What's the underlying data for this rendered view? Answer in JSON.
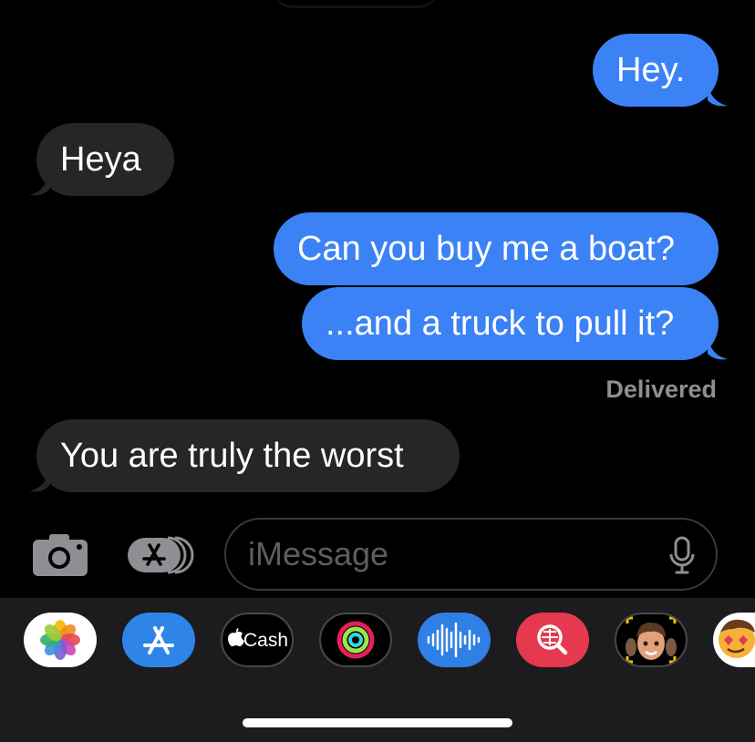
{
  "messages": [
    {
      "side": "sent",
      "text": "Hey."
    },
    {
      "side": "received",
      "text": "Heya"
    },
    {
      "side": "sent",
      "text": "Can you buy me a boat?"
    },
    {
      "side": "sent",
      "text": "...and a truck to pull it?"
    },
    {
      "side": "received",
      "text": "You are truly the worst"
    }
  ],
  "status": "Delivered",
  "compose": {
    "placeholder": "iMessage"
  },
  "apps": {
    "cash_label": "Cash",
    "items": [
      "photos-app-icon",
      "app-store-icon",
      "apple-cash-icon",
      "activity-icon",
      "audio-message-icon",
      "images-search-icon",
      "memoji-icon",
      "memoji-stickers-icon"
    ]
  },
  "colors": {
    "sent": "#3b82f6",
    "received": "#262629",
    "background": "#000000",
    "drawer": "#1c1c1e"
  }
}
